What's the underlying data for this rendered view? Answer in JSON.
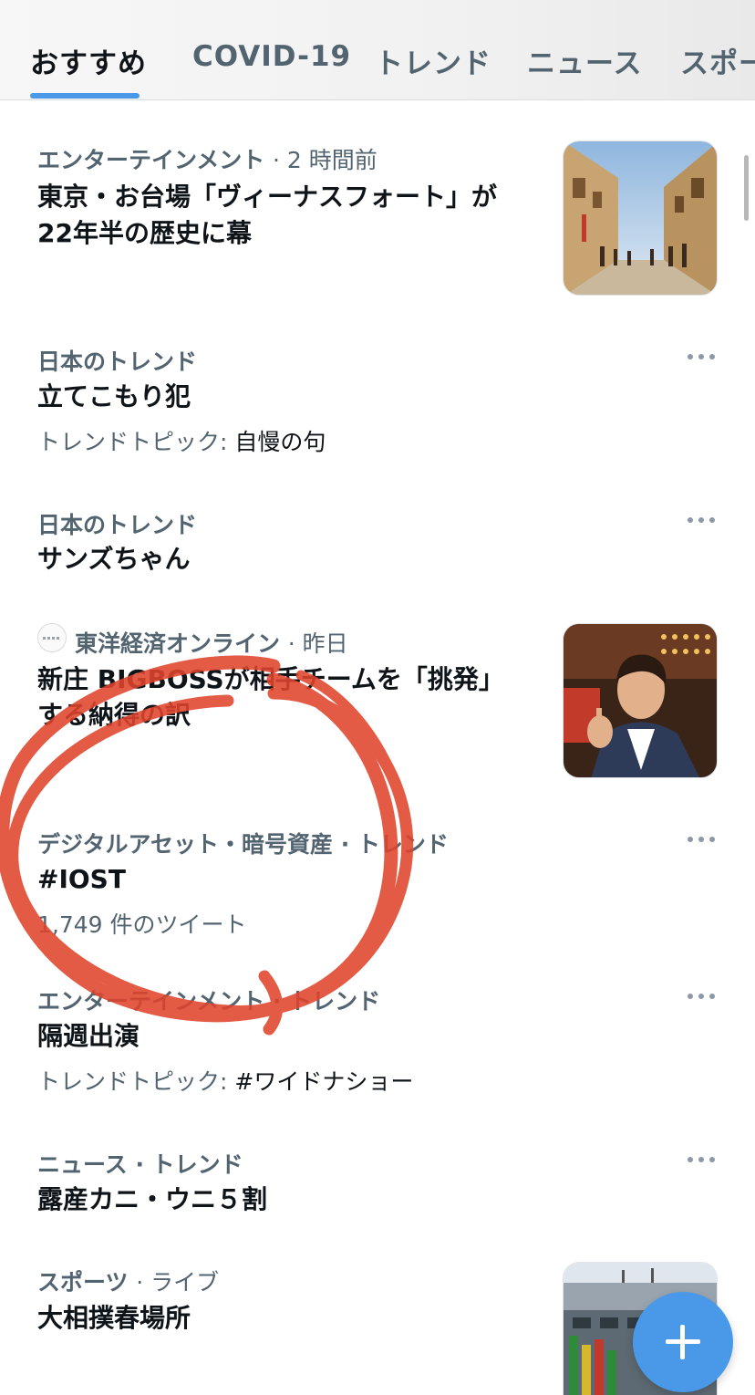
{
  "tabs": [
    {
      "label": "おすすめ"
    },
    {
      "label": "COVID-19"
    },
    {
      "label": "トレンド"
    },
    {
      "label": "ニュース"
    },
    {
      "label": "スポーツ"
    }
  ],
  "feed": [
    {
      "category": "エンターテインメント",
      "time": "· 2 時間前",
      "title_line1": "東京・お台場「ヴィーナスフォート」が",
      "title_line2": "22年半の歴史に幕"
    },
    {
      "category": "日本のトレンド",
      "title": "立てこもり犯",
      "topic_prefix": "トレンドトピック: ",
      "topic": "自慢の句"
    },
    {
      "category": "日本のトレンド",
      "title": "サンズちゃん"
    },
    {
      "source": "東洋経済オンライン",
      "time": "· 昨日",
      "title_line1": "新庄 BIGBOSSが相手チームを「挑発」",
      "title_line2": "する納得の訳"
    },
    {
      "category": "デジタルアセット・暗号資産 · トレンド",
      "title": "#IOST",
      "count": "1,749 件のツイート"
    },
    {
      "category": "エンターテインメント · トレンド",
      "title": "隔週出演",
      "topic_prefix": "トレンドトピック: ",
      "topic": "#ワイドナショー"
    },
    {
      "category": "ニュース · トレンド",
      "title": "露産カニ・ウニ５割"
    },
    {
      "category": "スポーツ",
      "time": "· ライブ",
      "title": "大相撲春場所"
    }
  ],
  "icons": {
    "more": "more-horizontal-icon",
    "compose": "plus-icon"
  },
  "colors": {
    "accent": "#4a99e9",
    "annotation": "#e0442c",
    "secondary_text": "#536471"
  }
}
